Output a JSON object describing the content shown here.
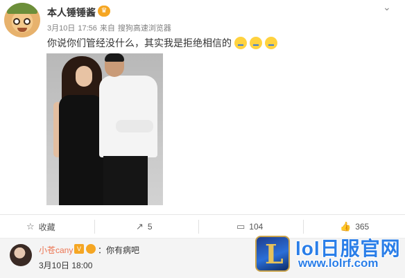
{
  "post": {
    "author": "本人锤锤酱",
    "date": "3月10日",
    "time": "17:56",
    "source_prefix": "来自",
    "source": "搜狗高速浏览器",
    "text": "你说你们管经没什么，其实我是拒绝相信的"
  },
  "actions": {
    "favorite_label": "收藏",
    "repost_count": "5",
    "comment_count": "104",
    "like_count": "365"
  },
  "comment": {
    "author": "小苍cany",
    "text": "：你有病吧",
    "date": "3月10日",
    "time": "18:00"
  },
  "watermark": {
    "logo_letter": "L",
    "title": "lol日服官网",
    "url": "www.lolrf.com"
  },
  "icons": {
    "avatar": "cartoon-avatar-icon",
    "chevron": "chevron-down-icon",
    "favorite": "star-icon",
    "repost": "repost-icon",
    "comment": "comment-icon",
    "like": "thumbs-up-icon",
    "emoji": "sad-emoji-icon"
  },
  "colors": {
    "comment_name": "#eb7350",
    "watermark": "#2a7ee8",
    "badge": "#f5a623"
  }
}
